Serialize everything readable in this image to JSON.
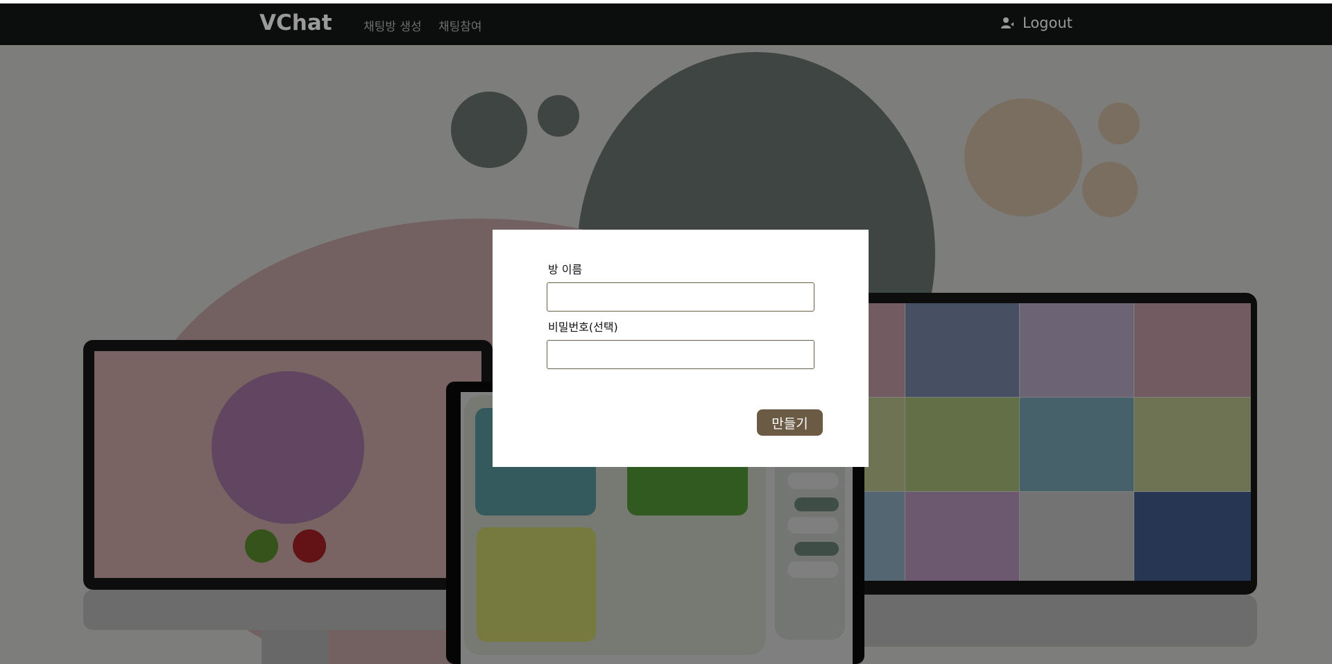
{
  "navbar": {
    "brand": "VChat",
    "links": [
      {
        "label": "채팅방 생성"
      },
      {
        "label": "채팅참여"
      }
    ],
    "logout_label": "Logout",
    "logout_icon": "user-icon"
  },
  "modal": {
    "room_name_label": "방 이름",
    "room_name_value": "",
    "password_label": "비밀번호(선택)",
    "password_value": "",
    "create_label": "만들기"
  },
  "colors": {
    "navbar_bg": "#0c0e0d",
    "button_bg": "#6b5b45",
    "input_border": "#6a5d48"
  }
}
